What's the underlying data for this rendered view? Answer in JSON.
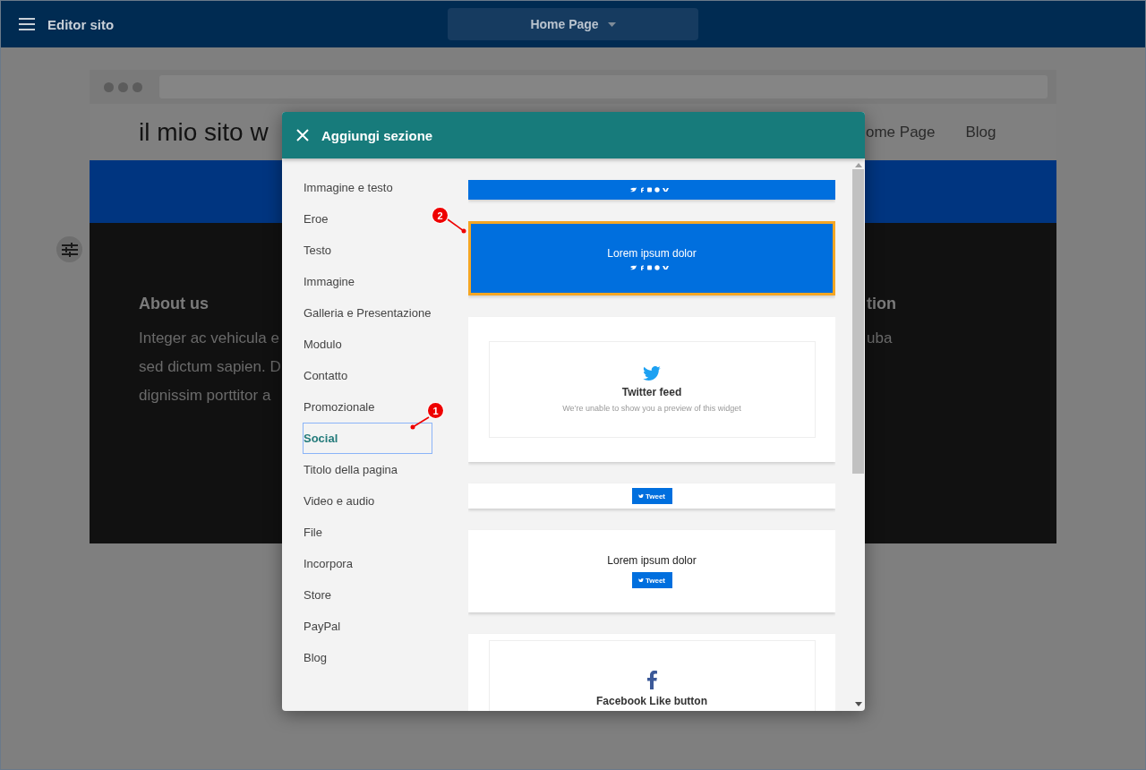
{
  "top_bar": {
    "title": "Editor sito",
    "page_selector": "Home Page"
  },
  "site": {
    "title": "il mio sito w",
    "nav": [
      "ome Page",
      "Blog"
    ],
    "footer_left": {
      "heading": "About us",
      "lines": [
        "Integer ac vehicula e",
        "sed dictum sapien. D",
        "dignissim porttitor a"
      ]
    },
    "footer_right": {
      "heading": "tion",
      "lines": [
        "uba"
      ]
    }
  },
  "dialog": {
    "title": "Aggiungi sezione",
    "categories": [
      {
        "label": "Immagine e testo",
        "selected": false
      },
      {
        "label": "Eroe",
        "selected": false
      },
      {
        "label": "Testo",
        "selected": false
      },
      {
        "label": "Immagine",
        "selected": false
      },
      {
        "label": "Galleria e Presentazione",
        "selected": false
      },
      {
        "label": "Modulo",
        "selected": false
      },
      {
        "label": "Contatto",
        "selected": false
      },
      {
        "label": "Promozionale",
        "selected": false
      },
      {
        "label": "Social",
        "selected": true
      },
      {
        "label": "Titolo della pagina",
        "selected": false
      },
      {
        "label": "Video e audio",
        "selected": false
      },
      {
        "label": "File",
        "selected": false
      },
      {
        "label": "Incorpora",
        "selected": false
      },
      {
        "label": "Store",
        "selected": false
      },
      {
        "label": "PayPal",
        "selected": false
      },
      {
        "label": "Blog",
        "selected": false
      }
    ],
    "templates": [
      {
        "kind": "icons-bar",
        "selected": false
      },
      {
        "kind": "hero",
        "title": "Lorem ipsum dolor",
        "selected": true
      },
      {
        "kind": "twitter-widget",
        "title": "Twitter feed",
        "note": "We’re unable to show you a preview of this widget",
        "selected": false
      },
      {
        "kind": "tweet-bar",
        "button": "Tweet",
        "selected": false
      },
      {
        "kind": "text-tweet",
        "title": "Lorem ipsum dolor",
        "button": "Tweet",
        "selected": false
      },
      {
        "kind": "facebook-widget",
        "title": "Facebook Like button",
        "selected": false
      }
    ]
  },
  "annotations": [
    {
      "label": "1"
    },
    {
      "label": "2"
    }
  ]
}
